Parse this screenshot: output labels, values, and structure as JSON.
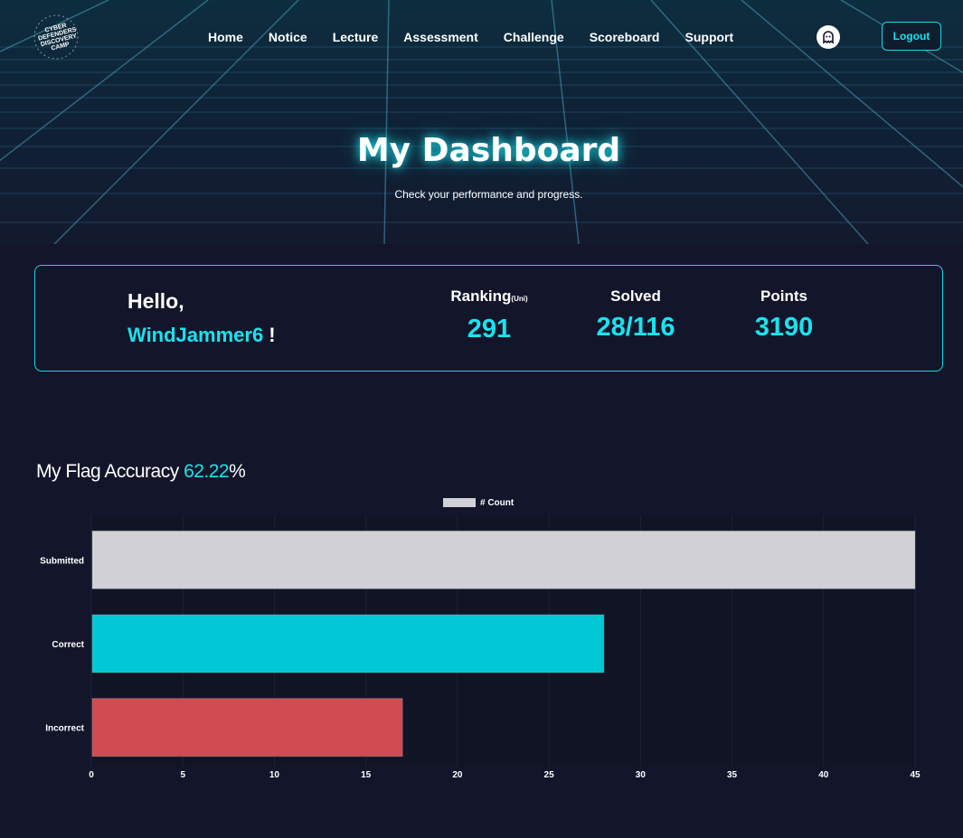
{
  "header": {
    "logo_text": "CYBER DEFENDERS DISCOVERY CAMP",
    "nav": [
      "Home",
      "Notice",
      "Lecture",
      "Assessment",
      "Challenge",
      "Scoreboard",
      "Support"
    ],
    "avatar_icon": "ghost-icon",
    "logout_label": "Logout"
  },
  "hero": {
    "title": "My Dashboard",
    "subtitle": "Check your performance and progress."
  },
  "stats": {
    "greeting": "Hello,",
    "username": "WindJammer6",
    "exclaim": " !",
    "ranking_label": "Ranking",
    "ranking_sub": "(Uni)",
    "ranking_value": "291",
    "solved_label": "Solved",
    "solved_value": "28/116",
    "points_label": "Points",
    "points_value": "3190"
  },
  "accuracy": {
    "label": "My Flag Accuracy ",
    "value": "62.22",
    "unit": "%"
  },
  "colors": {
    "accent": "#19e3ef",
    "submitted": "#d1d0d6",
    "correct": "#00c9d5",
    "incorrect": "#d14b52"
  },
  "chart_data": {
    "type": "bar",
    "orientation": "horizontal",
    "categories": [
      "Submitted",
      "Correct",
      "Incorrect"
    ],
    "series": [
      {
        "name": "# Count",
        "values": [
          45,
          28,
          17
        ]
      }
    ],
    "bar_colors": [
      "#d1d0d6",
      "#00c9d5",
      "#d14b52"
    ],
    "xlim": [
      0,
      45
    ],
    "xticks": [
      "0",
      "5",
      "10",
      "15",
      "20",
      "25",
      "30",
      "35",
      "40",
      "45"
    ],
    "legend": "top-center",
    "grid": true
  }
}
